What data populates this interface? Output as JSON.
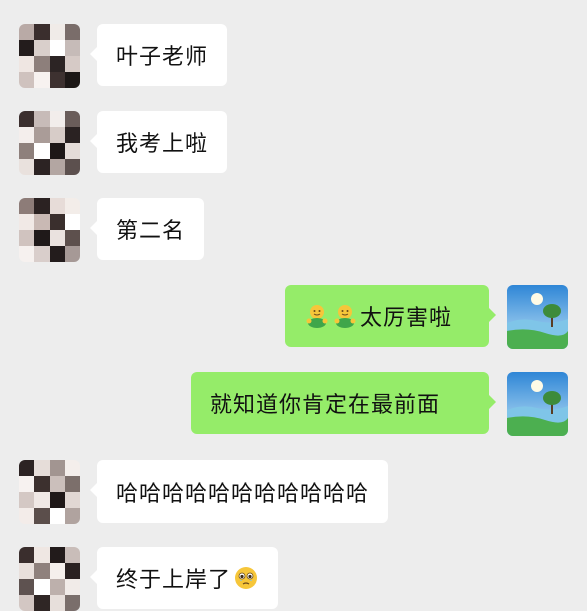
{
  "colors": {
    "background": "#ededed",
    "incoming_bubble": "#ffffff",
    "outgoing_bubble": "#95ec69"
  },
  "messages": [
    {
      "side": "left",
      "text": "叶子老师",
      "avatar": "pixelated-avatar"
    },
    {
      "side": "left",
      "text": "我考上啦",
      "avatar": "pixelated-avatar"
    },
    {
      "side": "left",
      "text": "第二名",
      "avatar": "pixelated-avatar"
    },
    {
      "side": "right",
      "text": "太厉害啦",
      "emojis": [
        "hug-emoji",
        "hug-emoji"
      ],
      "avatar": "landscape-avatar"
    },
    {
      "side": "right",
      "text": "就知道你肯定在最前面",
      "avatar": "landscape-avatar"
    },
    {
      "side": "left",
      "text": "哈哈哈哈哈哈哈哈哈哈哈",
      "avatar": "pixelated-avatar"
    },
    {
      "side": "left",
      "text": "终于上岸了",
      "trailing_emoji": "teary-eyes-emoji",
      "avatar": "pixelated-avatar"
    }
  ]
}
